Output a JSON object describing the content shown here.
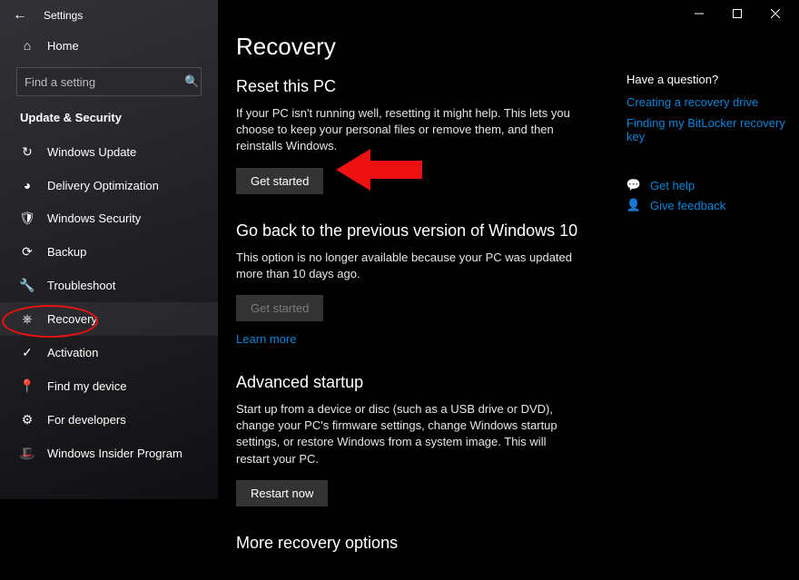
{
  "window": {
    "title": "Settings"
  },
  "sidebar": {
    "home": "Home",
    "search_placeholder": "Find a setting",
    "group": "Update & Security",
    "items": [
      {
        "label": "Windows Update",
        "icon": "sync-icon"
      },
      {
        "label": "Delivery Optimization",
        "icon": "optimize-icon"
      },
      {
        "label": "Windows Security",
        "icon": "shield-icon"
      },
      {
        "label": "Backup",
        "icon": "backup-icon"
      },
      {
        "label": "Troubleshoot",
        "icon": "wrench-icon"
      },
      {
        "label": "Recovery",
        "icon": "recovery-icon",
        "selected": true
      },
      {
        "label": "Activation",
        "icon": "check-icon"
      },
      {
        "label": "Find my device",
        "icon": "locate-icon"
      },
      {
        "label": "For developers",
        "icon": "dev-icon"
      },
      {
        "label": "Windows Insider Program",
        "icon": "insider-icon"
      }
    ]
  },
  "page": {
    "title": "Recovery",
    "reset": {
      "heading": "Reset this PC",
      "body": "If your PC isn't running well, resetting it might help. This lets you choose to keep your personal files or remove them, and then reinstalls Windows.",
      "button": "Get started"
    },
    "goback": {
      "heading": "Go back to the previous version of Windows 10",
      "body": "This option is no longer available because your PC was updated more than 10 days ago.",
      "button": "Get started",
      "learn": "Learn more"
    },
    "advanced": {
      "heading": "Advanced startup",
      "body": "Start up from a device or disc (such as a USB drive or DVD), change your PC's firmware settings, change Windows startup settings, or restore Windows from a system image. This will restart your PC.",
      "button": "Restart now"
    },
    "more_heading": "More recovery options"
  },
  "side": {
    "question": "Have a question?",
    "links": [
      "Creating a recovery drive",
      "Finding my BitLocker recovery key"
    ],
    "help": "Get help",
    "feedback": "Give feedback"
  }
}
